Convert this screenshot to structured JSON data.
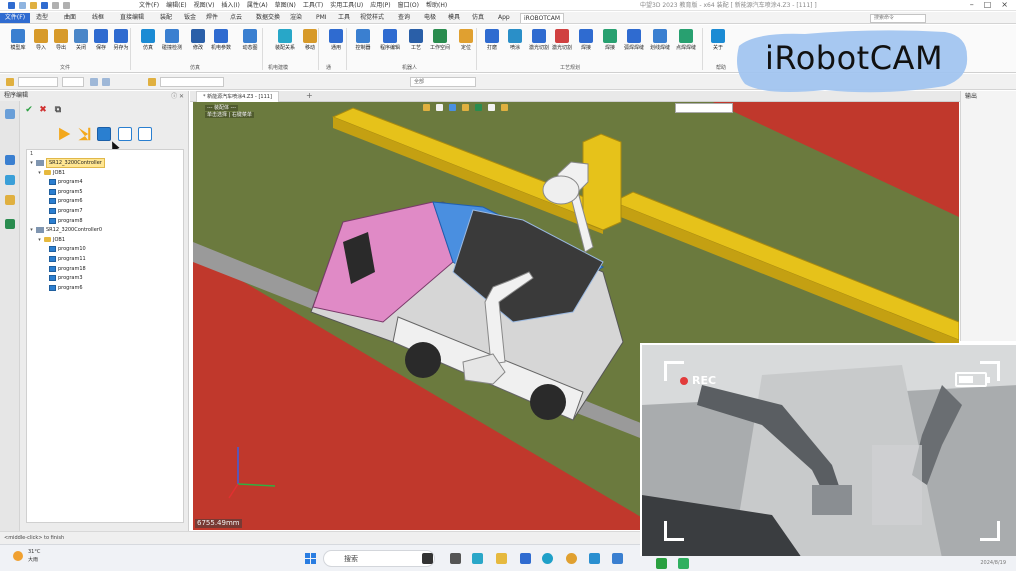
{
  "titlebar": {
    "menus": [
      "文件(F)",
      "编辑(E)",
      "视图(V)",
      "插入(I)",
      "属性(A)",
      "草图(N)",
      "工具(T)",
      "实用工具(U)",
      "应用(P)",
      "窗口(O)",
      "帮助(H)"
    ],
    "app_title": "中望3D 2023 教育版 - x64    装配    [ 新能源汽车喷涂4.Z3 - [111] ]"
  },
  "ribbon_tabs": {
    "file": "文件(F)",
    "items": [
      "造型",
      "曲面",
      "线框",
      "直接编辑",
      "装配",
      "钣金",
      "焊件",
      "点云",
      "数据交换",
      "渲染",
      "PMI",
      "工具",
      "视觉样式",
      "查询",
      "电极",
      "模具",
      "仿真",
      "App",
      "iROBOTCAM"
    ],
    "active": "iROBOTCAM",
    "search_placeholder": "搜索命令"
  },
  "ribbon_tools": [
    {
      "label": "模型库",
      "color": "#3a7fd0"
    },
    {
      "label": "导入",
      "color": "#d79a2a"
    },
    {
      "label": "导出",
      "color": "#d79a2a"
    },
    {
      "label": "关闭",
      "color": "#4a86c8"
    },
    {
      "label": "保存",
      "color": "#2f6bd0"
    },
    {
      "label": "另存为",
      "color": "#2f6bd0"
    },
    {
      "label": "仿真",
      "color": "#1b8bd4"
    },
    {
      "label": "碰撞检测",
      "color": "#3a7fd0"
    },
    {
      "label": "修改",
      "color": "#2a5fa8"
    },
    {
      "label": "机电参数",
      "color": "#2f6bd0"
    },
    {
      "label": "动态图",
      "color": "#3a7fd0"
    },
    {
      "label": "装配关系",
      "color": "#28a7c8"
    },
    {
      "label": "移动",
      "color": "#d79a2a"
    },
    {
      "label": "通用",
      "color": "#2f6bd0"
    },
    {
      "label": "控制器",
      "color": "#3a7fd0"
    },
    {
      "label": "程序编辑",
      "color": "#2f6bd0"
    },
    {
      "label": "工艺",
      "color": "#2a5fa8"
    },
    {
      "label": "工作空间",
      "color": "#2a8c4f"
    },
    {
      "label": "定位",
      "color": "#e0a030"
    },
    {
      "label": "打磨",
      "color": "#2f6bd0"
    },
    {
      "label": "喷涂",
      "color": "#2a8fc8"
    },
    {
      "label": "激光切割",
      "color": "#2f6bd0"
    },
    {
      "label": "激光切割",
      "color": "#d04040"
    },
    {
      "label": "焊接",
      "color": "#2f6bd0"
    },
    {
      "label": "焊接",
      "color": "#28a070"
    },
    {
      "label": "弧焊焊缝",
      "color": "#2f6bd0"
    },
    {
      "label": "划线焊缝",
      "color": "#3a7fd0"
    },
    {
      "label": "点焊焊缝",
      "color": "#28a070"
    },
    {
      "label": "关于",
      "color": "#1b8bd4"
    }
  ],
  "ribbon_groups": [
    "文件",
    "仿真",
    "机电建模",
    "通",
    "机器人",
    "工艺规划",
    "帮助"
  ],
  "toolbar2": {
    "field_hint": "全部"
  },
  "left_panel": {
    "title": "程序编辑",
    "tree_index": "1",
    "tree": [
      {
        "kind": "controller",
        "label": "SR12_3200Controller",
        "selected": true
      },
      {
        "kind": "job",
        "label": "JOB1"
      },
      {
        "kind": "program",
        "label": "program4"
      },
      {
        "kind": "program",
        "label": "program5"
      },
      {
        "kind": "program",
        "label": "program6"
      },
      {
        "kind": "program",
        "label": "program7"
      },
      {
        "kind": "program",
        "label": "program8"
      },
      {
        "kind": "controller",
        "label": "SR12_3200Controller0",
        "selected": false
      },
      {
        "kind": "job",
        "label": "JOB1"
      },
      {
        "kind": "program",
        "label": "program10"
      },
      {
        "kind": "program",
        "label": "program11"
      },
      {
        "kind": "program",
        "label": "program18"
      },
      {
        "kind": "program",
        "label": "program3"
      },
      {
        "kind": "program",
        "label": "program6"
      }
    ]
  },
  "doc_tab": {
    "label": "* 新能源汽车喷涂4.Z3 - [111]",
    "add": "+"
  },
  "viewport": {
    "note1": "--- 装配体 ---",
    "note2": "单击选择 | 右键菜单",
    "scale_text": "6755.49mm"
  },
  "right_strip": {
    "label": "输出"
  },
  "logo": {
    "text": "iRobotCAM"
  },
  "camera": {
    "rec_label": "REC",
    "battery_level": 0.6
  },
  "status": {
    "text": "<middle-click> to finish"
  },
  "taskbar": {
    "temp": "31°C",
    "weather": "大雨",
    "search": "搜索",
    "date": "2024/8/19"
  }
}
